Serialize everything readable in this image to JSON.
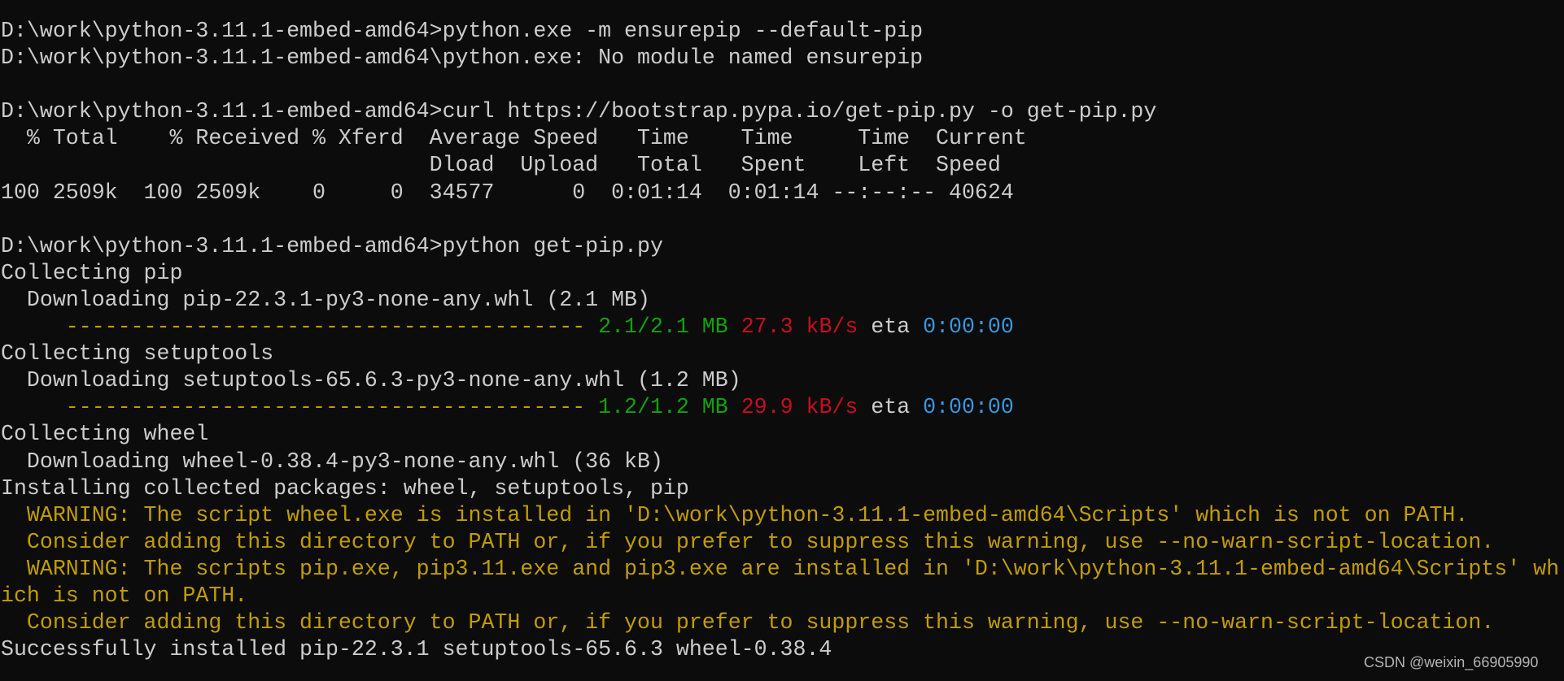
{
  "colors": {
    "background": "#0c0c0c",
    "default": "#cccccc",
    "yellow": "#c19c00",
    "green": "#13a10e",
    "red": "#c50f1f",
    "blue": "#3a96dd"
  },
  "lines": [
    [
      [
        "default",
        "D:\\work\\python-3.11.1-embed-amd64>python.exe -m ensurepip --default-pip"
      ]
    ],
    [
      [
        "default",
        "D:\\work\\python-3.11.1-embed-amd64\\python.exe: No module named ensurepip"
      ]
    ],
    [],
    [
      [
        "default",
        "D:\\work\\python-3.11.1-embed-amd64>curl https://bootstrap.pypa.io/get-pip.py -o get-pip.py"
      ]
    ],
    [
      [
        "default",
        "  % Total    % Received % Xferd  Average Speed   Time    Time     Time  Current"
      ]
    ],
    [
      [
        "default",
        "                                 Dload  Upload   Total   Spent    Left  Speed"
      ]
    ],
    [
      [
        "default",
        "100 2509k  100 2509k    0     0  34577      0  0:01:14  0:01:14 --:--:-- 40624"
      ]
    ],
    [],
    [
      [
        "default",
        "D:\\work\\python-3.11.1-embed-amd64>python get-pip.py"
      ]
    ],
    [
      [
        "default",
        "Collecting pip"
      ]
    ],
    [
      [
        "default",
        "  Downloading pip-22.3.1-py3-none-any.whl (2.1 MB)"
      ]
    ],
    [
      [
        "default",
        "     "
      ],
      [
        "yellow",
        "----------------------------------------"
      ],
      [
        "default",
        " "
      ],
      [
        "green",
        "2.1/2.1 MB"
      ],
      [
        "default",
        " "
      ],
      [
        "red",
        "27.3 kB/s"
      ],
      [
        "default",
        " eta "
      ],
      [
        "blue",
        "0:00:00"
      ]
    ],
    [
      [
        "default",
        "Collecting setuptools"
      ]
    ],
    [
      [
        "default",
        "  Downloading setuptools-65.6.3-py3-none-any.whl (1.2 MB)"
      ]
    ],
    [
      [
        "default",
        "     "
      ],
      [
        "yellow",
        "----------------------------------------"
      ],
      [
        "default",
        " "
      ],
      [
        "green",
        "1.2/1.2 MB"
      ],
      [
        "default",
        " "
      ],
      [
        "red",
        "29.9 kB/s"
      ],
      [
        "default",
        " eta "
      ],
      [
        "blue",
        "0:00:00"
      ]
    ],
    [
      [
        "default",
        "Collecting wheel"
      ]
    ],
    [
      [
        "default",
        "  Downloading wheel-0.38.4-py3-none-any.whl (36 kB)"
      ]
    ],
    [
      [
        "default",
        "Installing collected packages: wheel, setuptools, pip"
      ]
    ],
    [
      [
        "yellow",
        "  WARNING: The script wheel.exe is installed in 'D:\\work\\python-3.11.1-embed-amd64\\Scripts' which is not on PATH."
      ]
    ],
    [
      [
        "yellow",
        "  Consider adding this directory to PATH or, if you prefer to suppress this warning, use --no-warn-script-location."
      ]
    ],
    [
      [
        "yellow",
        "  WARNING: The scripts pip.exe, pip3.11.exe and pip3.exe are installed in 'D:\\work\\python-3.11.1-embed-amd64\\Scripts' wh"
      ]
    ],
    [
      [
        "yellow",
        "ich is not on PATH."
      ]
    ],
    [
      [
        "yellow",
        "  Consider adding this directory to PATH or, if you prefer to suppress this warning, use --no-warn-script-location."
      ]
    ],
    [
      [
        "default",
        "Successfully installed pip-22.3.1 setuptools-65.6.3 wheel-0.38.4"
      ]
    ]
  ],
  "watermark": "CSDN @weixin_66905990"
}
